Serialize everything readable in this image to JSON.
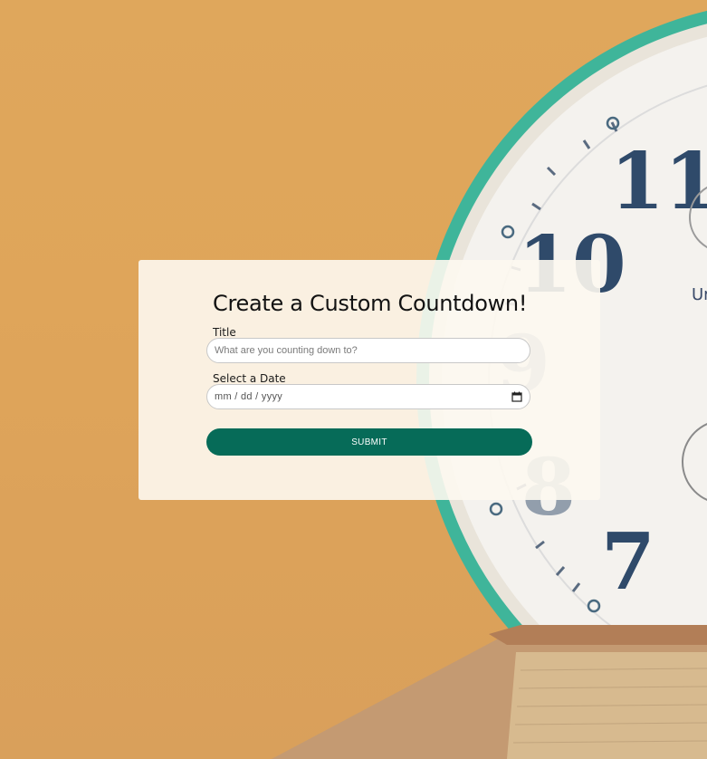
{
  "form": {
    "heading": "Create a Custom Countdown!",
    "title_label": "Title",
    "title_placeholder": "What are you counting down to?",
    "date_label": "Select a Date",
    "date_placeholder": "mm / dd / yyyy",
    "submit_label": "SUBMIT"
  },
  "background": {
    "description_icon": "alarm-clock-photo",
    "clock_numerals": [
      "11",
      "10",
      "9",
      "8",
      "7"
    ]
  },
  "colors": {
    "background": "#dfa55a",
    "card": "#fdf8f0",
    "button": "#066b58",
    "clock_rim": "#3fb59a",
    "clock_numeral": "#2f4a6a"
  },
  "icons": {
    "date": "calendar-icon"
  }
}
